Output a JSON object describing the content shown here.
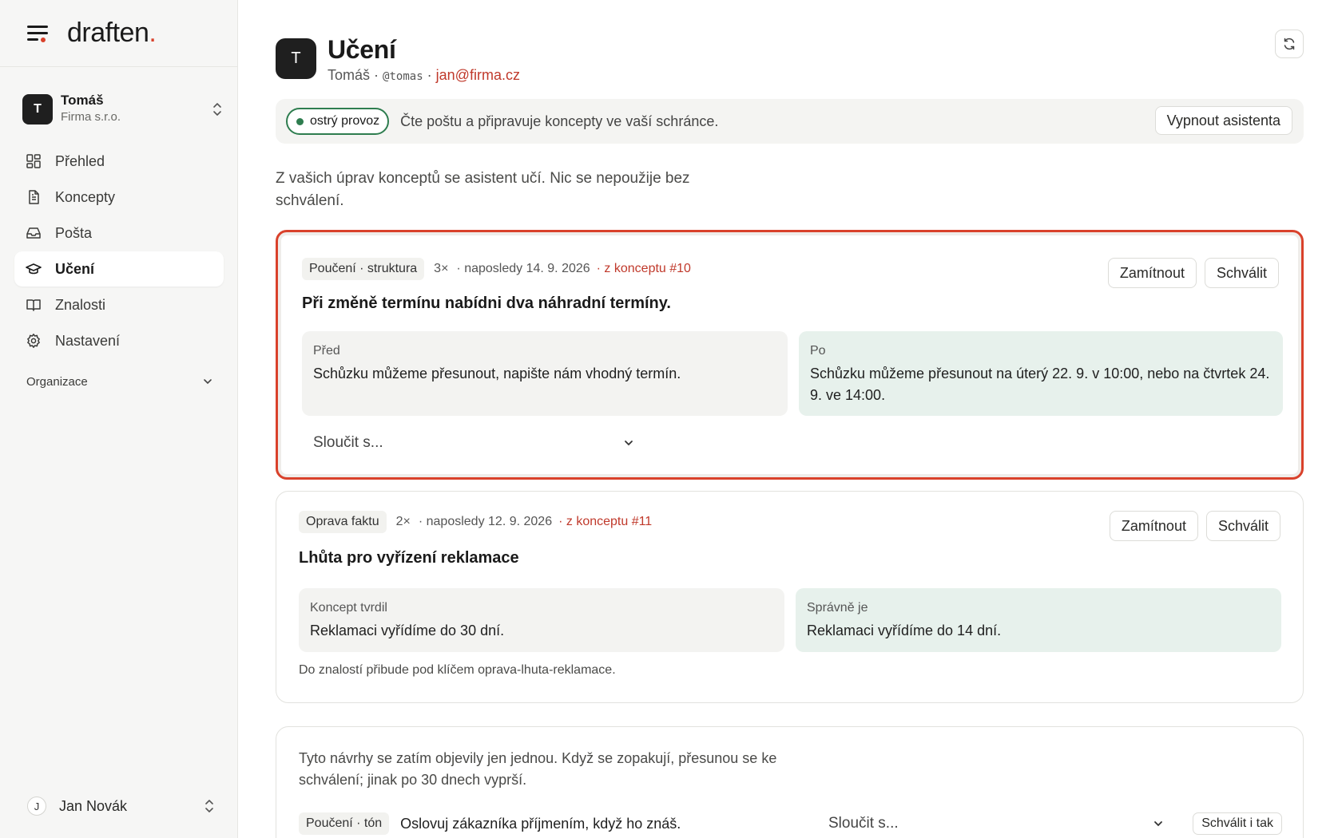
{
  "brand": {
    "name": "draften",
    "dot": "."
  },
  "workspace": {
    "initial": "T",
    "name": "Tomáš",
    "org": "Firma s.r.o."
  },
  "nav": [
    {
      "label": "Přehled",
      "icon": "grid-icon"
    },
    {
      "label": "Koncepty",
      "icon": "document-icon"
    },
    {
      "label": "Pošta",
      "icon": "inbox-icon"
    },
    {
      "label": "Učení",
      "icon": "graduation-cap-icon",
      "active": true
    },
    {
      "label": "Znalosti",
      "icon": "book-icon"
    },
    {
      "label": "Nastavení",
      "icon": "gear-icon"
    }
  ],
  "nav_section": "Organizace",
  "user": {
    "initial": "J",
    "name": "Jan Novák"
  },
  "page": {
    "avatar": "T",
    "title": "Učení",
    "name": "Tomáš",
    "separator": "·",
    "handle": "@tomas",
    "email": "jan@firma.cz"
  },
  "status": {
    "badge": "ostrý provoz",
    "text": "Čte poštu a připravuje koncepty ve vaší schránce.",
    "button": "Vypnout asistenta"
  },
  "intro": "Z vašich úprav konceptů se asistent učí. Nic se nepoužije bez schválení.",
  "actions": {
    "reject": "Zamítnout",
    "approve": "Schválit"
  },
  "cards": [
    {
      "tag": "Poučení · struktura",
      "count": "3×",
      "last": "· naposledy 14. 9. 2026",
      "source": "· z konceptu #10",
      "title": "Při změně termínu nabídni dva náhradní termíny.",
      "before_label": "Před",
      "before_text": "Schůzku můžeme přesunout, napište nám vhodný termín.",
      "after_label": "Po",
      "after_text": "Schůzku můžeme přesunout na úterý 22. 9. v 10:00, nebo na čtvrtek 24. 9. ve 14:00.",
      "merge_placeholder": "Sloučit s..."
    },
    {
      "tag": "Oprava faktu",
      "count": "2×",
      "last": "· naposledy 12. 9. 2026",
      "source": "· z konceptu #11",
      "title": "Lhůta pro vyřízení reklamace",
      "before_label": "Koncept tvrdil",
      "before_text": "Reklamaci vyřídíme do 30 dní.",
      "after_label": "Správně je",
      "after_text": "Reklamaci vyřídíme do 14 dní.",
      "note": "Do znalostí přibude pod klíčem oprava-lhuta-reklamace."
    }
  ],
  "pending": {
    "text": "Tyto návrhy se zatím objevily jen jednou. Když se zopakují, přesunou se ke schválení; jinak po 30 dnech vyprší.",
    "tag": "Poučení · tón",
    "rule": "Oslovuj zákazníka příjmením, když ho znáš.",
    "merge_placeholder": "Sloučit s...",
    "approve_anyway": "Schválit i tak"
  }
}
